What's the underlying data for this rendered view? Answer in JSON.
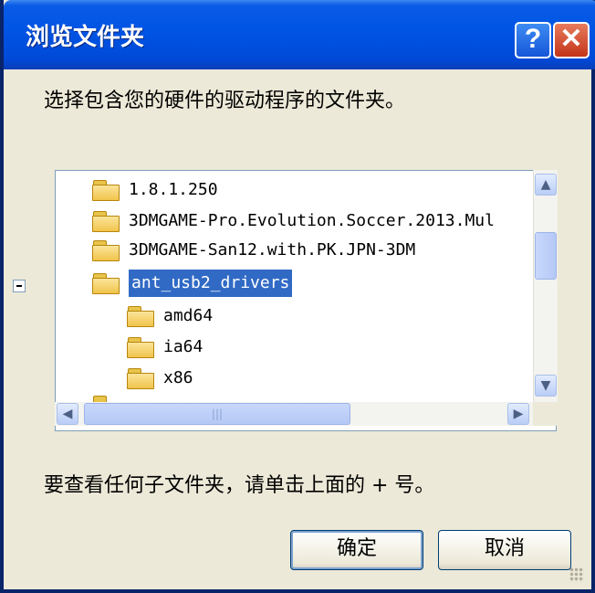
{
  "window": {
    "title": "浏览文件夹",
    "help_label": "?",
    "close_label": "✕"
  },
  "instruction": "选择包含您的硬件的驱动程序的文件夹。",
  "tree": {
    "items": [
      {
        "label": "1.8.1.250",
        "level": 0,
        "selected": false
      },
      {
        "label": "3DMGAME-Pro.Evolution.Soccer.2013.Mul",
        "level": 0,
        "selected": false
      },
      {
        "label": "3DMGAME-San12.with.PK.JPN-3DM",
        "level": 0,
        "selected": false
      },
      {
        "label": "ant_usb2_drivers",
        "level": 0,
        "selected": true,
        "expanded": true
      },
      {
        "label": "amd64",
        "level": 1,
        "selected": false
      },
      {
        "label": "ia64",
        "level": 1,
        "selected": false
      },
      {
        "label": "x86",
        "level": 1,
        "selected": false
      }
    ]
  },
  "hint": "要查看任何子文件夹，请单击上面的 + 号。",
  "buttons": {
    "ok": "确定",
    "cancel": "取消"
  },
  "scroll": {
    "up": "▲",
    "down": "▼",
    "left": "◀",
    "right": "▶",
    "hgrip": "|||"
  },
  "colors": {
    "title_bar": "#0055e5",
    "selection": "#316ac5",
    "dialog_bg": "#ece9d8"
  }
}
